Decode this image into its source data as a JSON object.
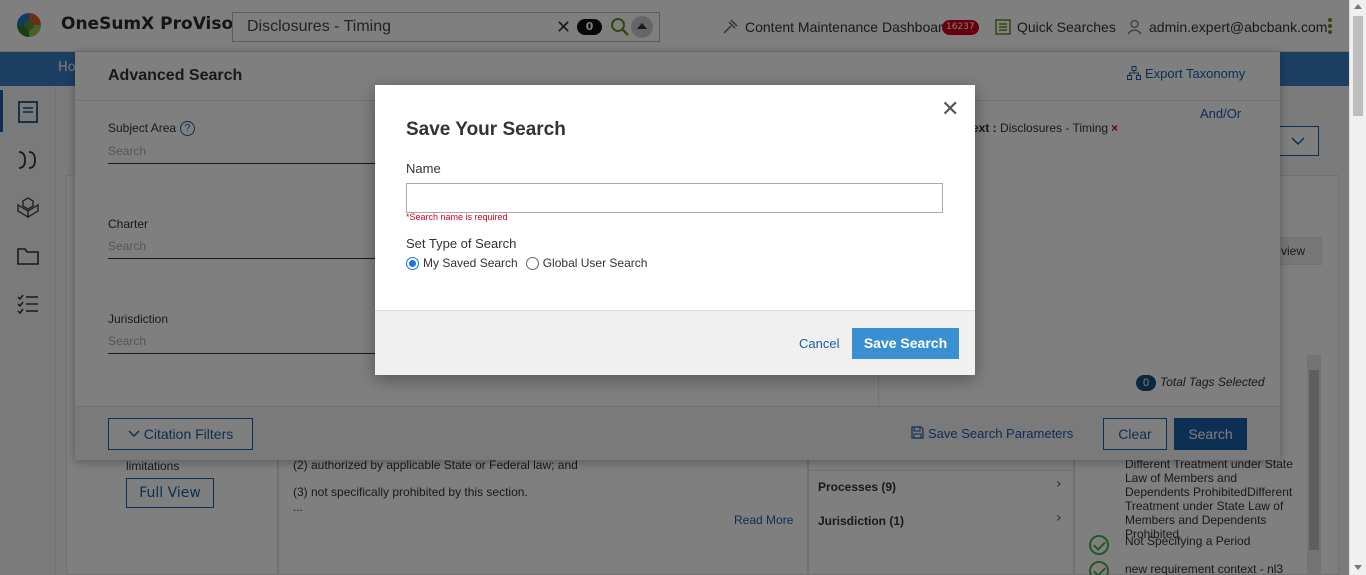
{
  "app": {
    "title": "OneSumX ProViso"
  },
  "header": {
    "search": {
      "value": "Disclosures - Timing",
      "result_count": "0"
    },
    "dashboard_label": "Content Maintenance Dashboard",
    "dashboard_badge": "16237",
    "quick_searches_label": "Quick Searches",
    "user_email": "admin.expert@abcbank.com"
  },
  "nav": {
    "partial_label": "Ho"
  },
  "advanced_search": {
    "title": "Advanced Search",
    "export_label": "Export Taxonomy",
    "fields": [
      {
        "label": "Subject Area",
        "placeholder": "Search",
        "has_help": true
      },
      {
        "label": "Charter",
        "placeholder": "Search"
      },
      {
        "label": "Jurisdiction",
        "placeholder": "Search"
      }
    ],
    "andor_label": "And/Or",
    "criteria_key": "ext :",
    "criteria_value": "Disclosures - Timing",
    "tags_count": "0",
    "tags_label": "Total Tags Selected",
    "citation_filters_label": "Citation Filters",
    "save_params_label": "Save Search Parameters",
    "clear_label": "Clear",
    "search_label": "Search"
  },
  "background": {
    "limitations": "limitations",
    "full_view": "Full View",
    "line1": "(2) authorized by applicable State or Federal law; and",
    "line2": "(3) not specifically prohibited by this section.",
    "ellipsis": "...",
    "read_more": "Read More",
    "facets": [
      {
        "label": "Processes (9)"
      },
      {
        "label": "Jurisdiction (1)"
      }
    ],
    "right_text": "Different Treatment under State Law of Members and Dependents ProhibitedDifferent Treatment under State Law of Members and Dependents Prohibited",
    "check_item_1": "Not Specifying a Period",
    "check_item_2": "new requirement context - nl3",
    "partial_view": "view"
  },
  "modal": {
    "title": "Save Your Search",
    "name_label": "Name",
    "name_value": "",
    "name_error": "*Search name is required",
    "type_label": "Set Type of Search",
    "options": [
      {
        "label": "My Saved Search",
        "checked": true
      },
      {
        "label": "Global User Search",
        "checked": false
      }
    ],
    "cancel_label": "Cancel",
    "save_label": "Save Search"
  },
  "colors": {
    "primary": "#1a5ea8",
    "save_button": "#3a8fd1",
    "error": "#d0021b",
    "nav_bar": "#3a7fc4"
  },
  "icons": [
    "logo-icon",
    "clear-icon",
    "search-icon",
    "chevron-up-icon",
    "dashboard-icon",
    "quick-search-icon",
    "user-icon",
    "kebab-menu-icon",
    "close-icon",
    "help-icon",
    "hierarchy-icon",
    "chevron-down-icon",
    "save-icon",
    "check-icon"
  ]
}
